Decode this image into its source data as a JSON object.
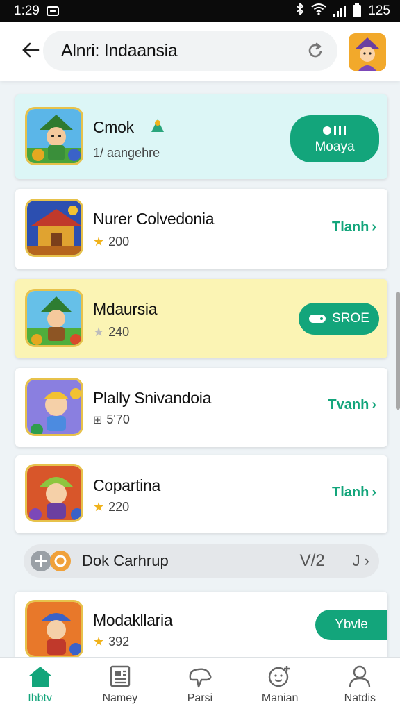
{
  "status_bar": {
    "time": "1:29",
    "battery": "125"
  },
  "header": {
    "search_text": "Alnri: Indaansia"
  },
  "games": [
    {
      "title": "Cmok",
      "subtitle": "1/ aangehre",
      "action": "Moaya",
      "action_type": "pill"
    },
    {
      "title": "Nurer Colvedonia",
      "rating": "200",
      "action": "Tlanh",
      "action_type": "link"
    },
    {
      "title": "Mdaursia",
      "rating": "240",
      "action": "SROE",
      "action_type": "pill"
    },
    {
      "title": "Plally Snivandoia",
      "rating": "5'70",
      "action": "Tvanh",
      "action_type": "link"
    },
    {
      "title": "Copartina",
      "rating": "220",
      "action": "Tlanh",
      "action_type": "link"
    },
    {
      "title": "Modakllaria",
      "rating": "392",
      "action": "Ybvle",
      "action_type": "pill"
    }
  ],
  "promo": {
    "label": "Dok Carhrup",
    "version": "V/2",
    "arrow_label": "J"
  },
  "nav": [
    {
      "label": "Ihbtv",
      "icon": "home-icon",
      "active": true
    },
    {
      "label": "Namey",
      "icon": "news-icon",
      "active": false
    },
    {
      "label": "Parsi",
      "icon": "cloud-icon",
      "active": false
    },
    {
      "label": "Manian",
      "icon": "add-user-icon",
      "active": false
    },
    {
      "label": "Natdis",
      "icon": "profile-icon",
      "active": false
    }
  ],
  "colors": {
    "accent": "#13a57b",
    "cyan_row": "#dcf6f6",
    "yellow_row": "#fbf4b4",
    "star": "#f0b21a"
  }
}
